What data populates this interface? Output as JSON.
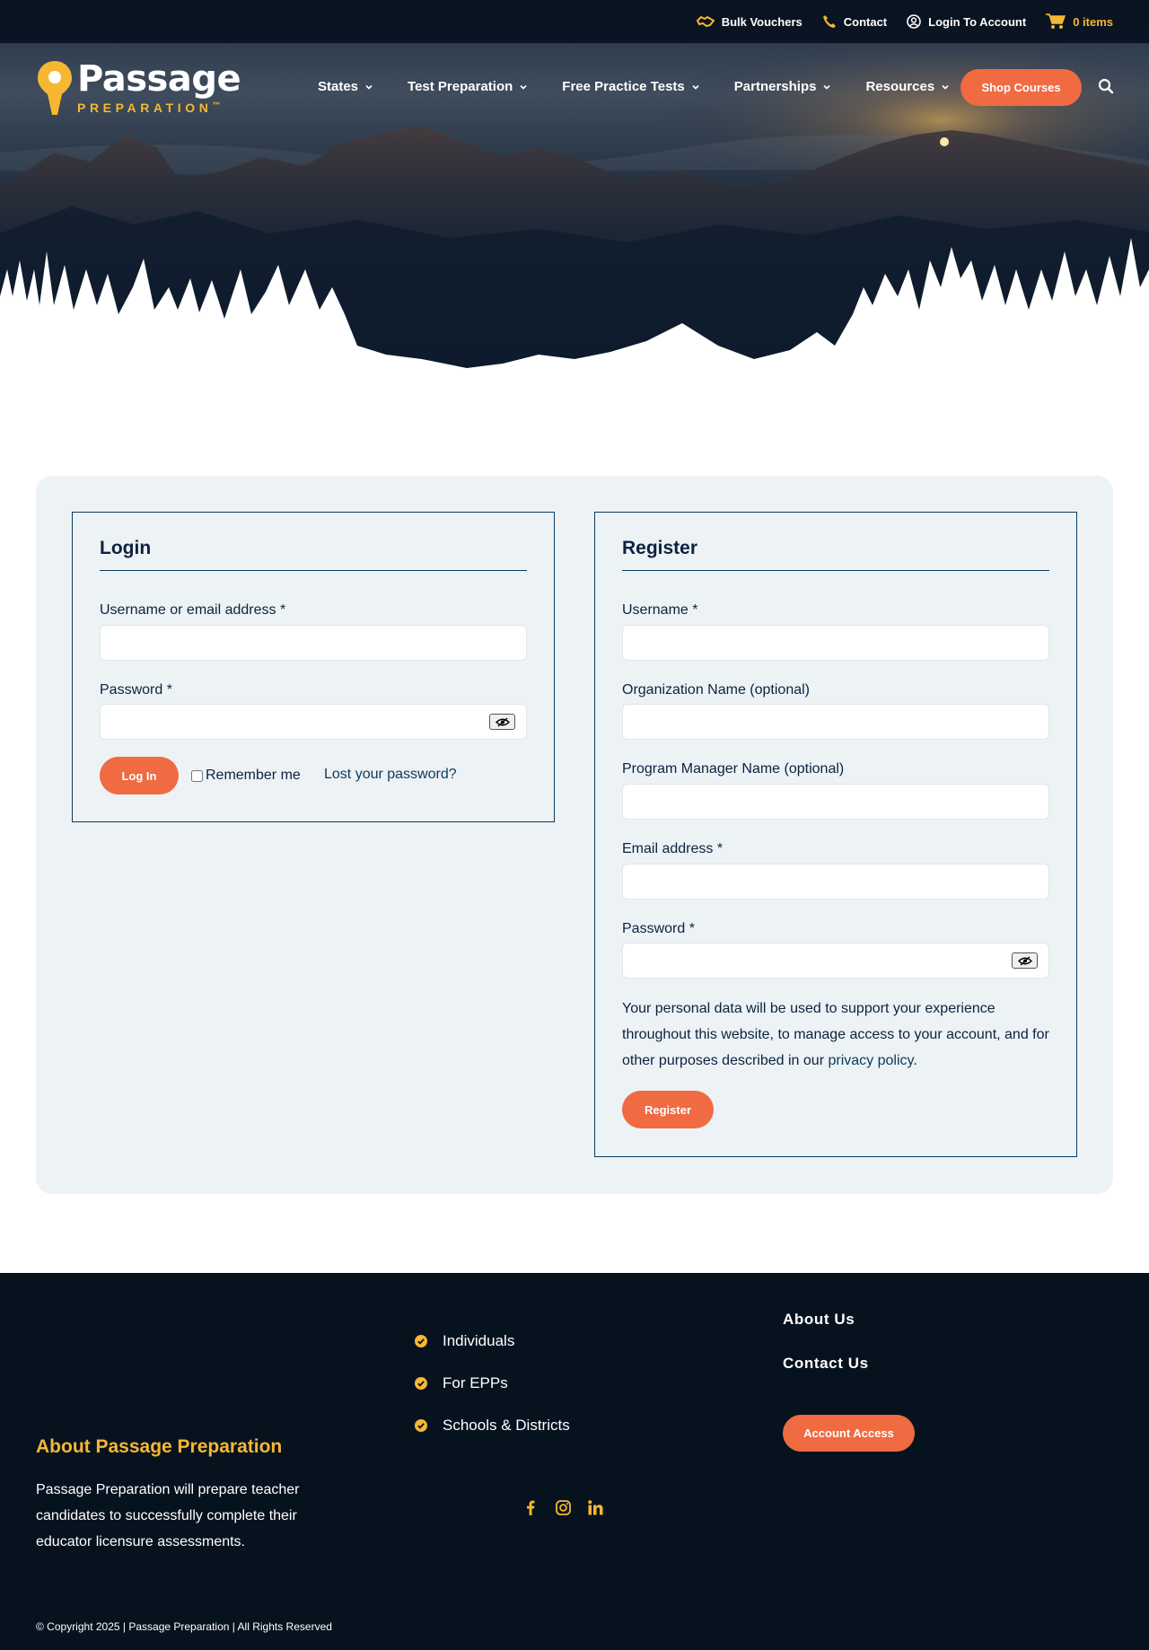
{
  "topbar": {
    "bulk_vouchers": "Bulk Vouchers",
    "contact": "Contact",
    "login": "Login To Account",
    "cart": "0 items",
    "icons": [
      "handshake-icon",
      "phone-icon",
      "user-circle-icon",
      "cart-icon"
    ]
  },
  "brand": {
    "name": "Passage",
    "tagline": "PREPARATION",
    "trademark": "™",
    "colors": {
      "navy": "#0b2340",
      "gold": "#f6b731",
      "orange": "#f06a42",
      "footer": "#07121f",
      "panel": "#edf2f5"
    }
  },
  "nav": {
    "items": [
      "States",
      "Test Preparation",
      "Free Practice Tests",
      "Partnerships",
      "Resources"
    ],
    "shop_label": "Shop Courses"
  },
  "login": {
    "title": "Login",
    "username_label": "Username or email address *",
    "username_value": "",
    "password_label": "Password *",
    "password_value": "",
    "submit_label": "Log In",
    "remember_label": "Remember me",
    "remember_checked": false,
    "lost_password": "Lost your password?"
  },
  "register": {
    "title": "Register",
    "username_label": "Username *",
    "org_label": "Organization Name (optional)",
    "manager_label": "Program Manager Name (optional)",
    "email_label": "Email address *",
    "password_label": "Password *",
    "privacy_text": "Your personal data will be used to support your experience throughout this website, to manage access to your account, and for other purposes described in our",
    "privacy_link": "privacy policy",
    "privacy_end": ".",
    "submit_label": "Register"
  },
  "footer": {
    "about_title": "About Passage Preparation",
    "about_text": "Passage Preparation will prepare teacher candidates to successfully complete their educator licensure assessments.",
    "audience": [
      "Individuals",
      "For EPPs",
      "Schools & Districts"
    ],
    "links": [
      "About Us",
      "Contact Us"
    ],
    "account_button": "Account Access",
    "social": [
      "facebook-icon",
      "instagram-icon",
      "linkedin-icon"
    ],
    "copyright": "© Copyright 2025 | Passage Preparation | All Rights Reserved"
  }
}
